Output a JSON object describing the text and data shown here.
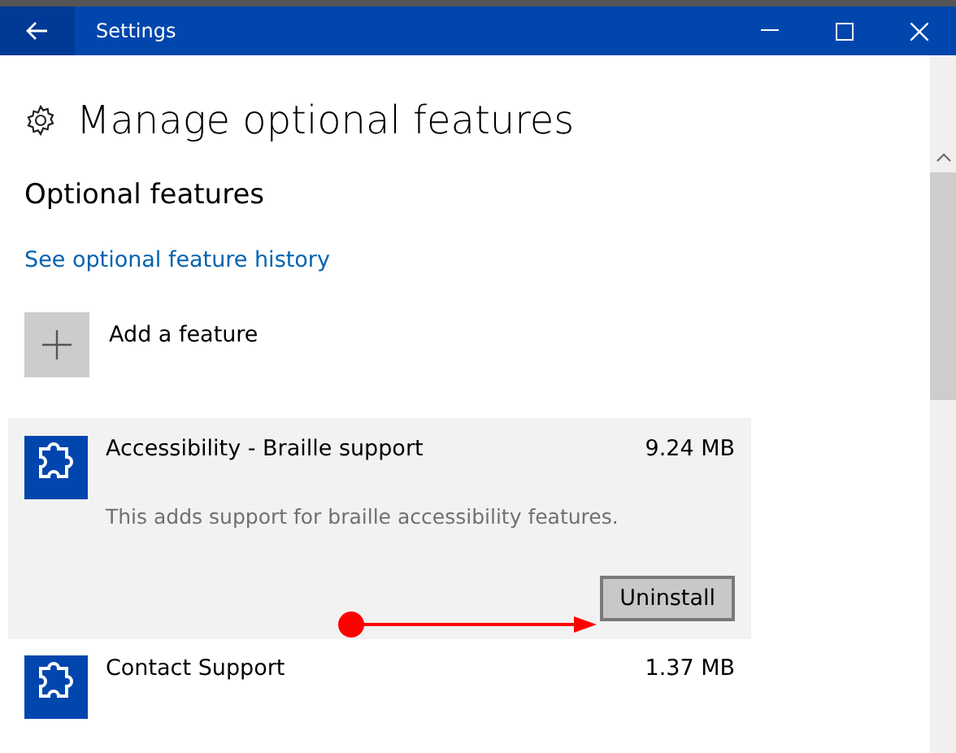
{
  "window": {
    "title": "Settings"
  },
  "page": {
    "title": "Manage optional features",
    "section": "Optional features",
    "history_link": "See optional feature history",
    "add_label": "Add a feature"
  },
  "features": [
    {
      "name": "Accessibility - Braille support",
      "size": "9.24 MB",
      "selected": true,
      "description": "This adds support for braille accessibility features.",
      "button": "Uninstall"
    },
    {
      "name": "Contact Support",
      "size": "1.37 MB",
      "selected": false
    }
  ]
}
